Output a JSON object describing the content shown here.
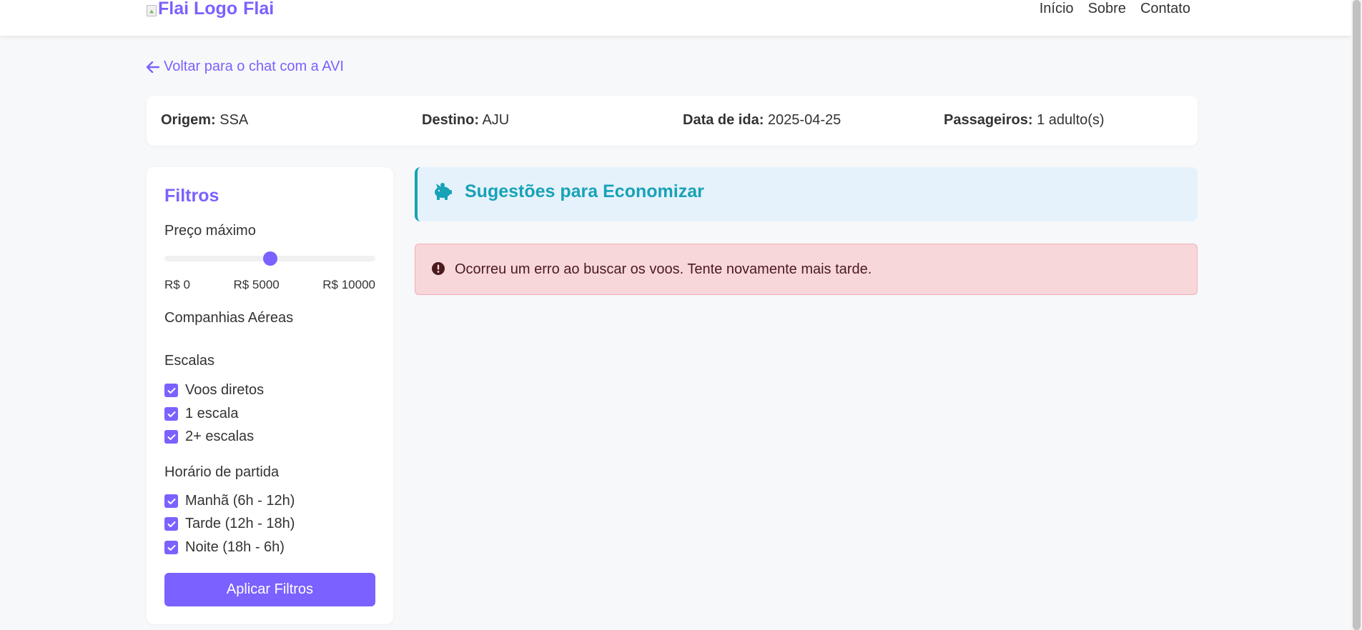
{
  "header": {
    "logo_alt": "Flai Logo",
    "logo_text": "Flai",
    "nav": [
      "Início",
      "Sobre",
      "Contato"
    ]
  },
  "back_link": "Voltar para o chat com a AVI",
  "summary": {
    "origin_label": "Origem:",
    "origin_value": "SSA",
    "destination_label": "Destino:",
    "destination_value": "AJU",
    "date_label": "Data de ida:",
    "date_value": "2025-04-25",
    "passengers_label": "Passageiros:",
    "passengers_value": "1 adulto(s)"
  },
  "filters": {
    "title": "Filtros",
    "max_price_label": "Preço máximo",
    "price_slider": {
      "min": 0,
      "max": 10000,
      "value": 5000
    },
    "price_min_label": "R$ 0",
    "price_mid_label": "R$ 5000",
    "price_max_label": "R$ 10000",
    "airlines_label": "Companhias Aéreas",
    "stops_label": "Escalas",
    "stops": [
      {
        "label": "Voos diretos",
        "checked": true
      },
      {
        "label": "1 escala",
        "checked": true
      },
      {
        "label": "2+ escalas",
        "checked": true
      }
    ],
    "departure_label": "Horário de partida",
    "departure": [
      {
        "label": "Manhã (6h - 12h)",
        "checked": true
      },
      {
        "label": "Tarde (12h - 18h)",
        "checked": true
      },
      {
        "label": "Noite (18h - 6h)",
        "checked": true
      }
    ],
    "apply_button": "Aplicar Filtros"
  },
  "suggestions": {
    "title": "Sugestões para Economizar",
    "icon": "piggy-bank-icon"
  },
  "error": {
    "message": "Ocorreu um erro ao buscar os voos. Tente novamente mais tarde.",
    "icon": "exclamation-circle-icon"
  },
  "colors": {
    "accent": "#7b61ff",
    "info": "#17a2b8",
    "error_bg": "#f8d7da",
    "error_text": "#721c24"
  }
}
